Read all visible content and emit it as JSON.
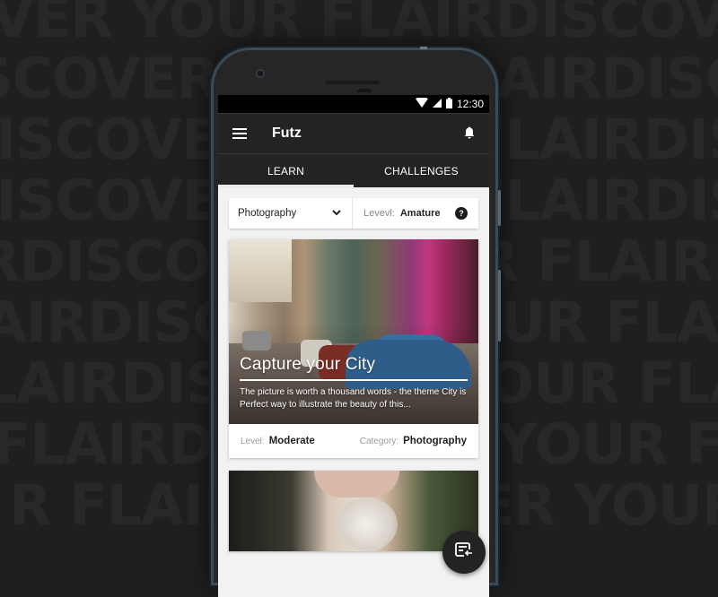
{
  "background": {
    "rows": [
      "VER YOUR FLAIRDISCOVER",
      "SCOVER YOUR FLAIRDISCO",
      "ISCOVER YOUR FLAIRDISCO",
      "DISCOVER YOUR FLAIRDISCO",
      "RDISCOVER YOUR FLAIRDIS",
      "AIRDISCOVER YOUR FLAIRD",
      "LAIRDISCOVER YOUR FLAIR",
      "FLAIRDISCOVER YOUR FLAI",
      "R FLAIRDISCOVER YOUR FL"
    ]
  },
  "status_bar": {
    "time": "12:30",
    "icons": [
      "wifi-icon",
      "signal-icon",
      "battery-icon"
    ]
  },
  "app_bar": {
    "title": "Futz",
    "menu_icon": "menu-icon",
    "notification_icon": "bell-icon"
  },
  "tabs": [
    {
      "label": "LEARN",
      "active": true
    },
    {
      "label": "CHALLENGES",
      "active": false
    }
  ],
  "filter": {
    "category_selected": "Photography",
    "level_label": "Levevl:",
    "level_value": "Amature",
    "help_icon": "?"
  },
  "cards": [
    {
      "title": "Capture your City",
      "description": "The picture is worth a thousand words - the theme City is Perfect way to illustrate the beauty of this...",
      "level_label": "Level:",
      "level_value": "Moderate",
      "category_label": "Category:",
      "category_value": "Photography"
    }
  ],
  "fab": {
    "icon": "add-to-list-icon"
  },
  "colors": {
    "app_bar": "#232323",
    "status_bar": "#000000",
    "content_bg": "#f2f2f2",
    "phone_frame": "#3a4a56",
    "page_bg": "#1f1f1f"
  }
}
